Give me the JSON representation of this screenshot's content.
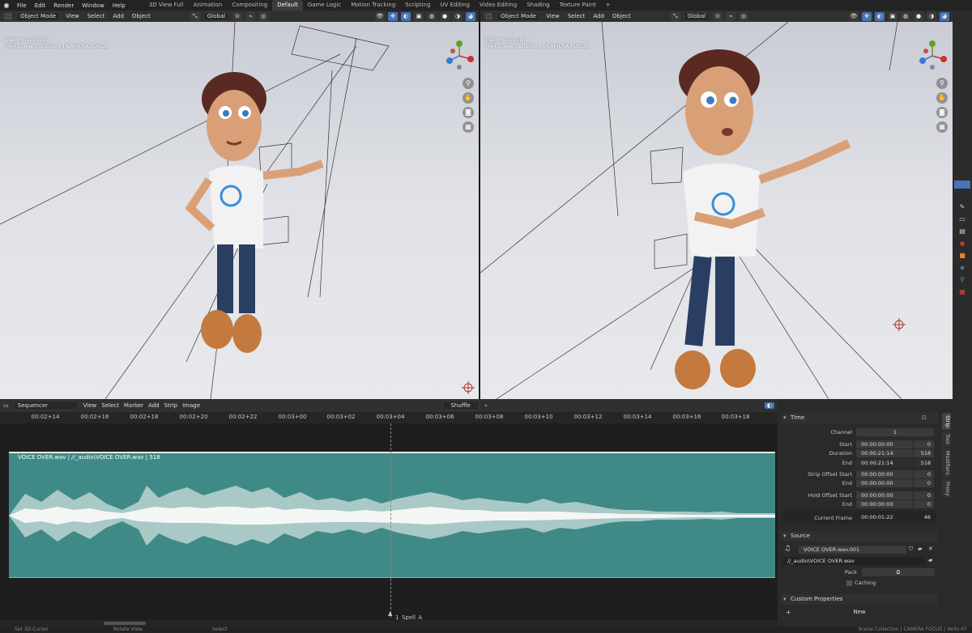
{
  "topbar": {
    "menus": [
      "File",
      "Edit",
      "Render",
      "Window",
      "Help"
    ],
    "workspaces": [
      "3D View Full",
      "Animation",
      "Compositing",
      "Default",
      "Game Logic",
      "Motion Tracking",
      "Scripting",
      "UV Editing",
      "Video Editing",
      "Shading",
      "Texture Paint"
    ],
    "active_workspace": "Default",
    "add_tab": "+"
  },
  "viewport_left": {
    "mode": "Object Mode",
    "menus": [
      "View",
      "Select",
      "Add",
      "Object"
    ],
    "orientation": "Global",
    "info_line1": "User Perspective",
    "info_line2": "(46) Scene Collection | CAMERA FOCUS"
  },
  "viewport_right": {
    "mode": "Object Mode",
    "menus": [
      "View",
      "Select",
      "Add",
      "Object"
    ],
    "orientation": "Global",
    "info_line1": "User Perspective",
    "info_line2": "(46) Scene Collection | CAMERA FOCUS"
  },
  "sequencer": {
    "editor": "Sequencer",
    "menus": [
      "View",
      "Select",
      "Marker",
      "Add",
      "Strip",
      "Image"
    ],
    "overlap_mode": "Shuffle",
    "ruler_ticks": [
      "00:02+14",
      "00:02+16",
      "00:02+18",
      "00:02+20",
      "00:02+22",
      "00:03+00",
      "00:03+02",
      "00:03+04",
      "00:03+06",
      "00:03+08",
      "00:03+10",
      "00:03+12",
      "00:03+14",
      "00:03+16",
      "00:03+18"
    ],
    "strip_label": "VOICE OVER.wav | //_audio\\VOICE OVER.wav | 518",
    "marker_label": "1_Spell_A"
  },
  "properties": {
    "tabs": [
      "Strip",
      "Tool",
      "Modifiers",
      "Proxy"
    ],
    "time_panel": {
      "title": "Time",
      "channel_label": "Channel",
      "channel": "1",
      "start_label": "Start",
      "start": "00:00:00:00",
      "start_frame": "0",
      "duration_label": "Duration",
      "duration": "00:00:21:14",
      "duration_frames": "518",
      "end_label": "End",
      "end": "00:00:21:14",
      "end_frame": "518",
      "strip_offset_start_label": "Strip Offset Start",
      "strip_offset_start": "00:00:00:00",
      "strip_offset_start_frame": "0",
      "strip_offset_end_label": "End",
      "strip_offset_end": "00:00:00:00",
      "strip_offset_end_frame": "0",
      "hold_offset_start_label": "Hold Offset Start",
      "hold_offset_start": "00:00:00:00",
      "hold_offset_start_frame": "0",
      "hold_offset_end_label": "End",
      "hold_offset_end": "00:00:00:00",
      "hold_offset_end_frame": "0",
      "current_frame_label": "Current Frame",
      "current_frame": "00:00:01:22",
      "current_frame_num": "46"
    },
    "source_panel": {
      "title": "Source",
      "sound_name": "VOICE OVER.wav.001",
      "filepath": "//_audio\\VOICE OVER.wav",
      "pack_label": "Pack",
      "caching_label": "Caching"
    },
    "custom_panel": {
      "title": "Custom Properties",
      "new_label": "New"
    }
  },
  "statusbar": {
    "items": [
      "Set 3D Cursor",
      "Rotate View",
      "Select"
    ],
    "right": "Scene Collection | CAMERA FOCUS | Verts:47"
  }
}
